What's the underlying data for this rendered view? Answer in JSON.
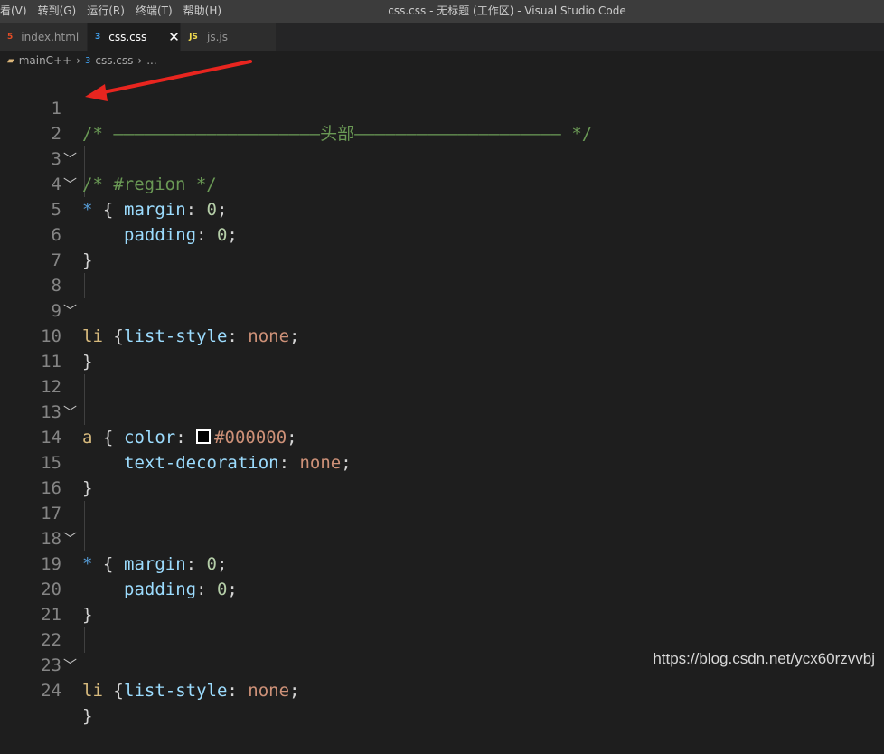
{
  "window_title": "css.css - 无标题 (工作区) - Visual Studio Code",
  "menu": [
    "看(V)",
    "转到(G)",
    "运行(R)",
    "终端(T)",
    "帮助(H)"
  ],
  "tabs": [
    {
      "label": "index.html",
      "icon": "html-file-icon",
      "glyph": "5"
    },
    {
      "label": "css.css",
      "icon": "css-file-icon",
      "glyph": "3"
    },
    {
      "label": "js.js",
      "icon": "js-file-icon",
      "glyph": "JS"
    }
  ],
  "close_glyph": "✕",
  "breadcrumb": {
    "folder": "mainC++",
    "file": "css.css",
    "more": "..."
  },
  "line_numbers": [
    "1",
    "2",
    "3",
    "4",
    "5",
    "6",
    "7",
    "8",
    "9",
    "10",
    "11",
    "12",
    "13",
    "14",
    "15",
    "16",
    "17",
    "18",
    "19",
    "20",
    "21",
    "22",
    "23",
    "24"
  ],
  "code": {
    "l1": "/* ————————————————————头部———————————————————— */",
    "l2": "/* #region */",
    "star": "*",
    "brace_open": " {",
    "brace_close": "}",
    "margin": "margin",
    "padding": "padding",
    "zero": "0",
    "li": "li",
    "a": "a",
    "list_style": "list-style",
    "none": "none",
    "color": "color",
    "color_value": "#000000",
    "text_decoration": "text-decoration"
  },
  "colors": {
    "swatch": "#000000",
    "annotation_arrow": "#e8251f"
  },
  "watermark": "https://blog.csdn.net/ycx60rzvvbj"
}
